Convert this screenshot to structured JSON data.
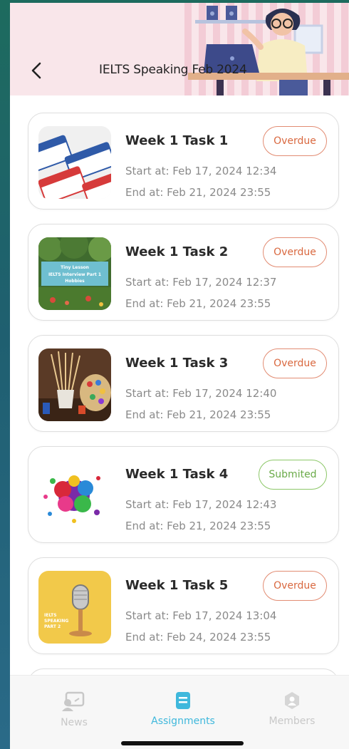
{
  "header": {
    "title": "IELTS Speaking Feb 2024",
    "back_icon": "chevron-left-icon"
  },
  "assignments": [
    {
      "title": "Week 1 Task 1",
      "start": "Start at: Feb 17, 2024 12:34",
      "end": "End at: Feb 21, 2024 23:55",
      "status": "Overdue",
      "thumb": "name-tags"
    },
    {
      "title": "Week 1 Task 2",
      "start": "Start at: Feb 17, 2024 12:37",
      "end": "End at: Feb 21, 2024 23:55",
      "status": "Overdue",
      "thumb": "hobbies-garden",
      "thumb_text": [
        "Tiny Lesson",
        "IELTS Interview Part 1",
        "Hobbies"
      ]
    },
    {
      "title": "Week 1 Task 3",
      "start": "Start at: Feb 17, 2024 12:40",
      "end": "End at: Feb 21, 2024 23:55",
      "status": "Overdue",
      "thumb": "paint-brushes"
    },
    {
      "title": "Week 1 Task 4",
      "start": "Start at: Feb 17, 2024 12:43",
      "end": "End at: Feb 21, 2024 23:55",
      "status": "Submited",
      "thumb": "paint-splash"
    },
    {
      "title": "Week 1 Task 5",
      "start": "Start at: Feb 17, 2024 13:04",
      "end": "End at: Feb 24, 2024 23:55",
      "status": "Overdue",
      "thumb": "microphone",
      "thumb_text": [
        "IELTS",
        "SPEAKING",
        "PART 2"
      ]
    }
  ],
  "bottom_nav": {
    "items": [
      {
        "label": "News",
        "icon": "news-icon",
        "active": false
      },
      {
        "label": "Assignments",
        "icon": "assignments-icon",
        "active": true
      },
      {
        "label": "Members",
        "icon": "members-icon",
        "active": false
      }
    ]
  },
  "colors": {
    "overdue": "#d9683f",
    "submitted": "#6aaa48",
    "accent": "#3fb8dc",
    "header_bg": "#f9e6ea"
  }
}
